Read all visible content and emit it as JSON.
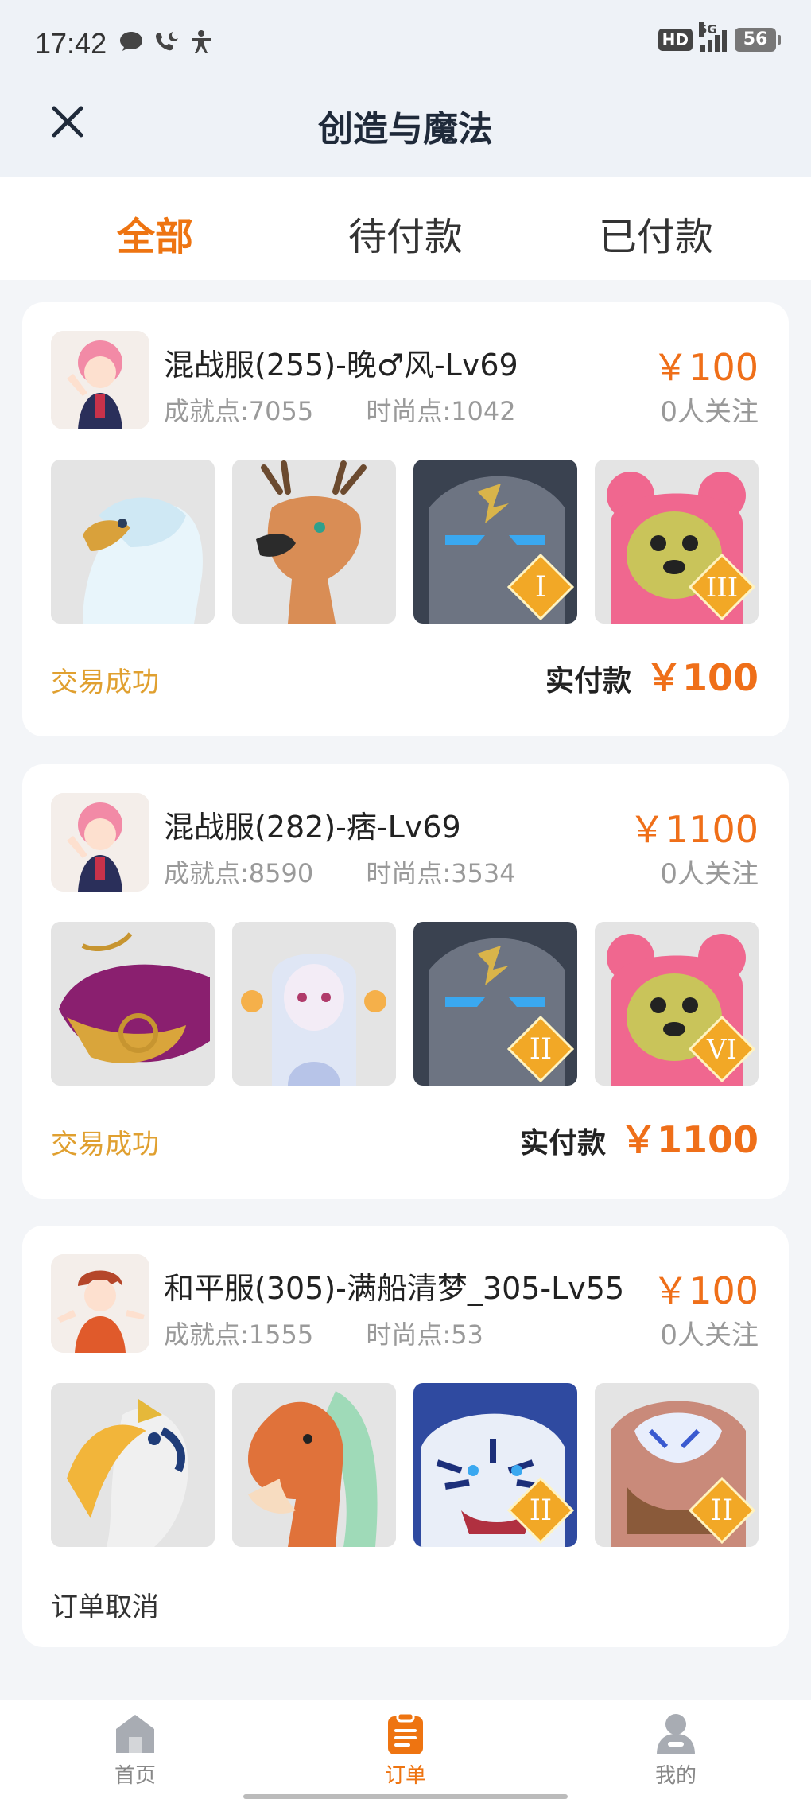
{
  "status_bar": {
    "time": "17:42",
    "hd": "HD",
    "network": "5G",
    "battery": "56"
  },
  "header": {
    "title": "创造与魔法"
  },
  "tabs": [
    {
      "label": "全部",
      "active": true
    },
    {
      "label": "待付款",
      "active": false
    },
    {
      "label": "已付款",
      "active": false
    }
  ],
  "orders": [
    {
      "name": "混战服(255)-晚♂风-Lv69",
      "achievement": "成就点:7055",
      "fashion": "时尚点:1042",
      "price": "￥100",
      "followers": "0人关注",
      "pets": [
        {
          "icon": "white-eagle-pet-icon"
        },
        {
          "icon": "deer-pet-icon"
        },
        {
          "icon": "stone-beast-pet-icon",
          "rank": "I"
        },
        {
          "icon": "pink-bear-pet-icon",
          "rank": "III"
        }
      ],
      "status": "交易成功",
      "paid_label": "实付款",
      "paid_amount": "￥100"
    },
    {
      "name": "混战服(282)-痞-Lv69",
      "achievement": "成就点:8590",
      "fashion": "时尚点:3534",
      "price": "￥1100",
      "followers": "0人关注",
      "pets": [
        {
          "icon": "golden-whale-pet-icon"
        },
        {
          "icon": "white-spirit-pet-icon"
        },
        {
          "icon": "stone-beast-pet-icon",
          "rank": "II"
        },
        {
          "icon": "pink-bear-pet-icon",
          "rank": "VI"
        }
      ],
      "status": "交易成功",
      "paid_label": "实付款",
      "paid_amount": "￥1100"
    },
    {
      "name": "和平服(305)-满船清梦_305-Lv55",
      "achievement": "成就点:1555",
      "fashion": "时尚点:53",
      "price": "￥100",
      "followers": "0人关注",
      "pets": [
        {
          "icon": "hornbill-pet-icon"
        },
        {
          "icon": "orange-horse-pet-icon"
        },
        {
          "icon": "white-tiger-pet-icon",
          "rank": "II"
        },
        {
          "icon": "lion-beast-pet-icon",
          "rank": "II"
        }
      ],
      "status": "订单取消"
    }
  ],
  "bottom_nav": [
    {
      "label": "首页",
      "icon": "home-icon",
      "active": false
    },
    {
      "label": "订单",
      "icon": "order-icon",
      "active": true
    },
    {
      "label": "我的",
      "icon": "profile-icon",
      "active": false
    }
  ],
  "colors": {
    "accent": "#ee7411",
    "price": "#ef6f19",
    "success": "#e0a030",
    "background": "#f3f5f8"
  }
}
